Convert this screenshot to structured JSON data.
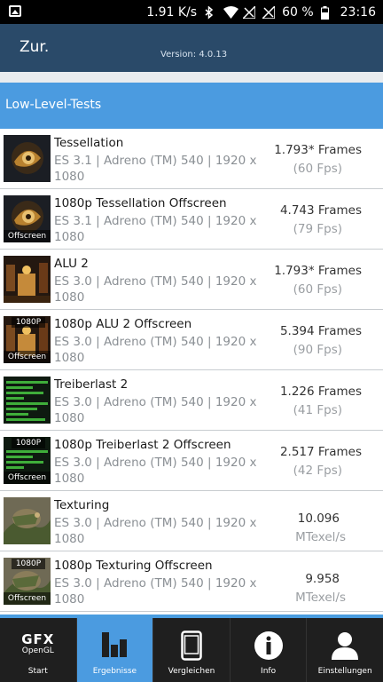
{
  "status": {
    "speed": "1.91 K/s",
    "battery": "60 %",
    "time": "23:16"
  },
  "header": {
    "back_label": "Zur.",
    "version": "Version: 4.0.13"
  },
  "section": {
    "title": "Low-Level-Tests"
  },
  "tests": [
    {
      "name": "Tessellation",
      "desc": "ES 3.1 | Adreno (TM) 540 | 1920 x 1080",
      "result": "1.793* Frames",
      "sub": "(60 Fps)"
    },
    {
      "name": "1080p Tessellation Offscreen",
      "desc": "ES 3.1 | Adreno (TM) 540 | 1920 x 1080",
      "result": "4.743 Frames",
      "sub": "(79 Fps)",
      "badge": "Offscreen"
    },
    {
      "name": "ALU 2",
      "desc": "ES 3.0 | Adreno (TM) 540 | 1920 x 1080",
      "result": "1.793* Frames",
      "sub": "(60 Fps)"
    },
    {
      "name": "1080p ALU 2 Offscreen",
      "desc": "ES 3.0 | Adreno (TM) 540 | 1920 x 1080",
      "result": "5.394 Frames",
      "sub": "(90 Fps)",
      "badge": "Offscreen",
      "badge_top": "1080P"
    },
    {
      "name": "Treiberlast 2",
      "desc": "ES 3.0 | Adreno (TM) 540 | 1920 x 1080",
      "result": "1.226 Frames",
      "sub": "(41 Fps)"
    },
    {
      "name": "1080p Treiberlast 2 Offscreen",
      "desc": "ES 3.0 | Adreno (TM) 540 | 1920 x 1080",
      "result": "2.517 Frames",
      "sub": "(42 Fps)",
      "badge": "Offscreen",
      "badge_top": "1080P"
    },
    {
      "name": "Texturing",
      "desc": "ES 3.0 | Adreno (TM) 540 | 1920 x 1080",
      "result": "10.096",
      "sub": "MTexel/s"
    },
    {
      "name": "1080p Texturing Offscreen",
      "desc": "ES 3.0 | Adreno (TM) 540 | 1920 x 1080",
      "result": "9.958",
      "sub": "MTexel/s",
      "badge": "Offscreen",
      "badge_top": "1080P"
    }
  ],
  "nav": {
    "gfx": "GFX",
    "opengl": "OpenGL",
    "tabs": [
      {
        "label": "Start",
        "icon": "gfx-logo-icon"
      },
      {
        "label": "Ergebnisse",
        "icon": "bar-chart-icon"
      },
      {
        "label": "Vergleichen",
        "icon": "phone-icon"
      },
      {
        "label": "Info",
        "icon": "info-icon"
      },
      {
        "label": "Einstellungen",
        "icon": "person-icon"
      }
    ]
  },
  "colors": {
    "appbar": "#2a4a69",
    "section": "#4b9be0",
    "nav_active": "#4b9be0"
  }
}
